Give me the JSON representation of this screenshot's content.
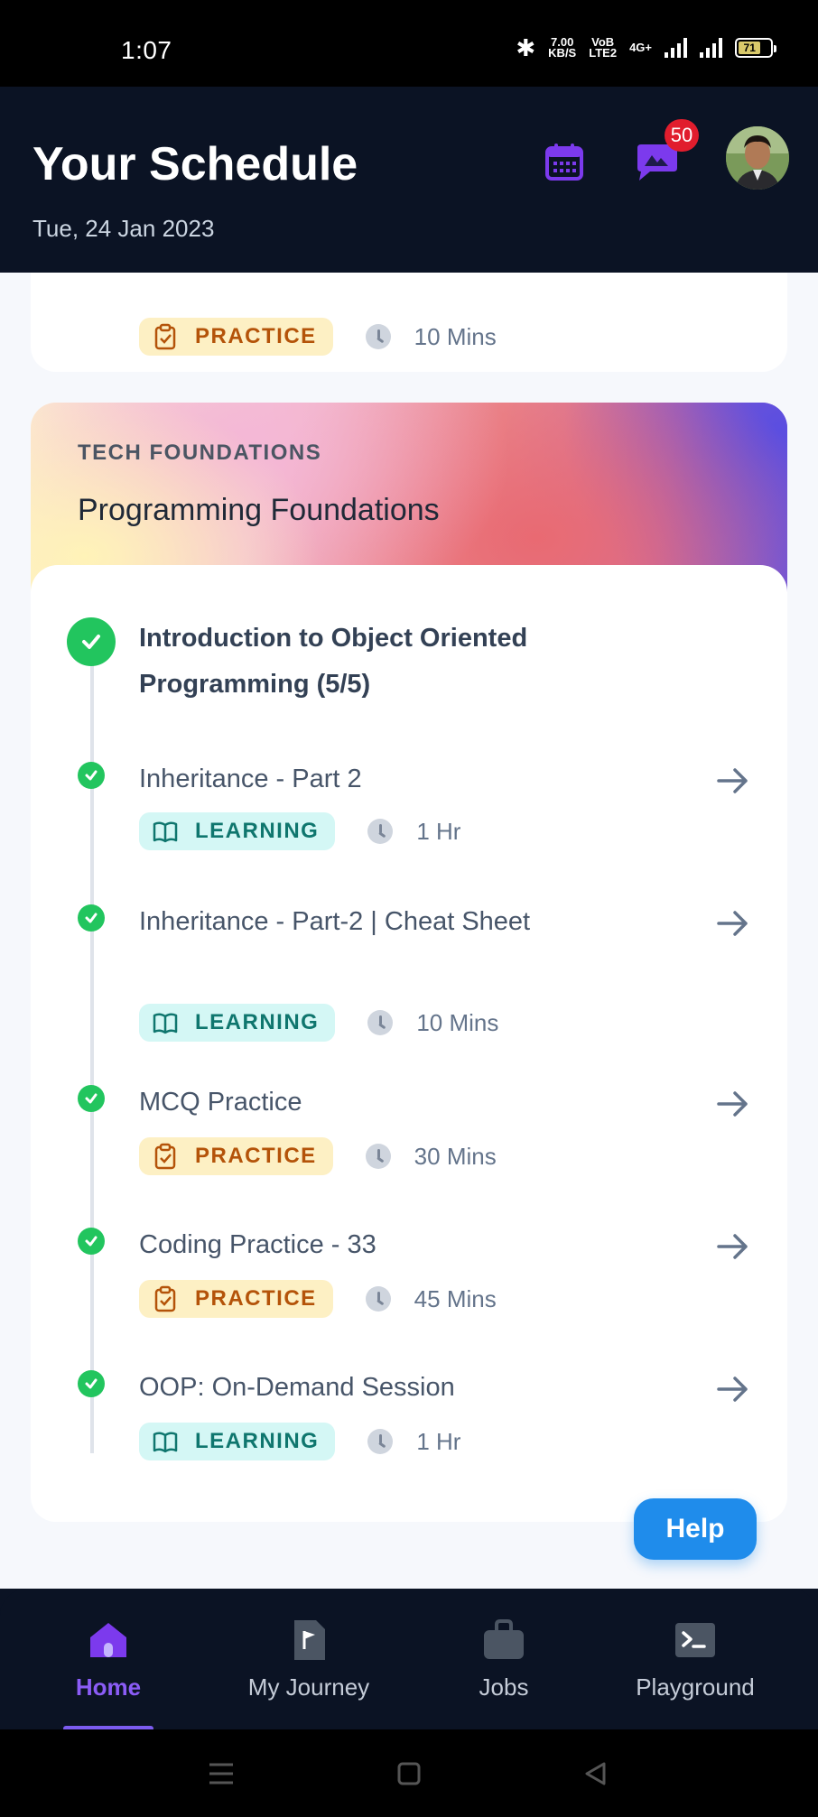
{
  "status_bar": {
    "time": "1:07",
    "net_speed": "7.00",
    "net_unit": "KB/S",
    "volte_top": "VoB",
    "volte_bottom": "LTE2",
    "network": "4G+",
    "battery": "71"
  },
  "header": {
    "title": "Your Schedule",
    "date": "Tue, 24 Jan 2023",
    "notification_count": "50",
    "calendar_icon": "calendar-icon",
    "chat_icon": "chat-icon"
  },
  "previous_item": {
    "tag": "PRACTICE",
    "duration": "10 Mins"
  },
  "course": {
    "category": "TECH FOUNDATIONS",
    "title": "Programming Foundations",
    "module_title": "Introduction to Object Oriented Programming (5/5)",
    "items": [
      {
        "title": "Inheritance - Part 2",
        "tag": "LEARNING",
        "duration": "1 Hr"
      },
      {
        "title": "Inheritance - Part-2 | Cheat Sheet",
        "tag": "LEARNING",
        "duration": "10 Mins"
      },
      {
        "title": "MCQ Practice",
        "tag": "PRACTICE",
        "duration": "30 Mins"
      },
      {
        "title": "Coding Practice - 33",
        "tag": "PRACTICE",
        "duration": "45 Mins"
      },
      {
        "title": "OOP: On-Demand Session",
        "tag": "LEARNING",
        "duration": "1 Hr"
      }
    ]
  },
  "help_button": "Help",
  "bottom_nav": {
    "items": [
      {
        "label": "Home",
        "icon": "home-icon",
        "active": true
      },
      {
        "label": "My Journey",
        "icon": "flag-icon",
        "active": false
      },
      {
        "label": "Jobs",
        "icon": "briefcase-icon",
        "active": false
      },
      {
        "label": "Playground",
        "icon": "terminal-icon",
        "active": false
      }
    ]
  },
  "colors": {
    "header_bg": "#0b1324",
    "accent": "#8b5cf6",
    "success": "#22c55e",
    "learning_bg": "#d4f7f5",
    "practice_bg": "#fdf0c4",
    "help_blue": "#1f8ceb",
    "badge_red": "#e11d2d"
  }
}
